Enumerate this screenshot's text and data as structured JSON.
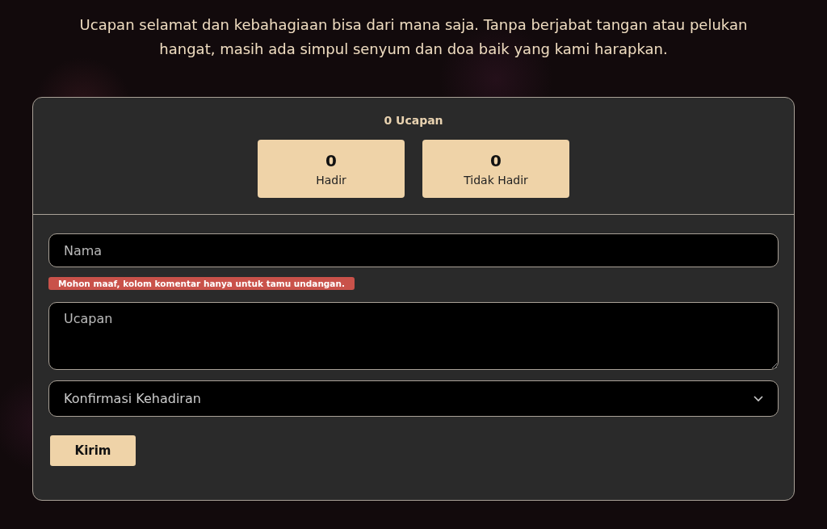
{
  "intro": "Ucapan selamat dan kebahagiaan bisa dari mana saja. Tanpa berjabat tangan atau pelukan hangat, masih ada simpul senyum dan doa baik yang kami harapkan.",
  "wishes": {
    "count_label": "0 Ucapan",
    "stats": [
      {
        "value": "0",
        "label": "Hadir"
      },
      {
        "value": "0",
        "label": "Tidak Hadir"
      }
    ],
    "form": {
      "name": {
        "placeholder": "Nama"
      },
      "error": "Mohon maaf, kolom komentar hanya untuk tamu undangan.",
      "message": {
        "placeholder": "Ucapan"
      },
      "attendance": {
        "placeholder": "Konfirmasi Kehadiran"
      },
      "submit": "Kirim"
    }
  }
}
